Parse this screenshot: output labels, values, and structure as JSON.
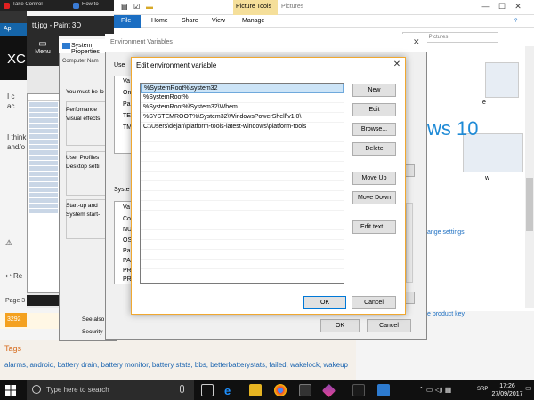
{
  "browser": {
    "tabs": [
      "Take Control",
      "How to"
    ],
    "blue_strip_text": "Ap",
    "dark_panel_text": "XC",
    "body_snippets": [
      "I c",
      "ac",
      "I think",
      "and/o"
    ],
    "button_re": "Re",
    "page_label": "Page 3",
    "number_badge": "3292",
    "tags_title": "Tags",
    "tags_list": "alarms, android, battery drain, battery monitor, battery stats, bbs, betterbatterystats, failed, wakelock, wakeup"
  },
  "paint": {
    "title": "tt.jpg - Paint 3D",
    "menu_label": "Menu"
  },
  "explorer": {
    "picture_tools": "Picture Tools",
    "pictures_title": "Pictures",
    "ribbon_tabs": [
      "File",
      "Home",
      "Share",
      "View",
      "Manage"
    ],
    "search_placeholder": "Search Pictures",
    "win10_text": "ws 10",
    "change_settings": "ange settings",
    "product_key": "e product key",
    "thumb_e": "e",
    "thumb_w": "w"
  },
  "system_properties": {
    "title": "System Properties",
    "tab_text": "Computer Nam",
    "lines": [
      "You must be lo",
      "Perfomance",
      "Visual effects",
      "User Profiles",
      "Desktop setti",
      "Start-up and",
      "System start-",
      "See also",
      "Security"
    ]
  },
  "env_vars": {
    "title": "Environment Variables",
    "user_label": "Use",
    "user_cols": [
      "Va",
      "On",
      "Pa",
      "TE",
      "TM"
    ],
    "sys_label": "Syste",
    "sys_cols": [
      "Va",
      "Co",
      "NU",
      "OS",
      "Pa",
      "PA",
      "PR",
      "PR"
    ],
    "ok": "OK",
    "cancel": "Cancel"
  },
  "edit_dialog": {
    "title": "Edit environment variable",
    "entries": [
      "%SystemRoot%\\system32",
      "%SystemRoot%",
      "%SystemRoot%\\System32\\Wbem",
      "%SYSTEMROOT%\\System32\\WindowsPowerShell\\v1.0\\",
      "C:\\Users\\dejan\\platform-tools-latest-windows\\platform-tools"
    ],
    "buttons": {
      "new": "New",
      "edit": "Edit",
      "browse": "Browse...",
      "delete": "Delete",
      "move_up": "Move Up",
      "move_down": "Move Down",
      "edit_text": "Edit text..."
    },
    "ok": "OK",
    "cancel": "Cancel"
  },
  "taskbar": {
    "search_placeholder": "Type here to search",
    "language": "SRP",
    "time": "17:26",
    "date": "27/09/2017"
  },
  "colors": {
    "accent": "#0078d7",
    "selection": "#cce4f7",
    "badge": "#f4a11f",
    "tag_link": "#1a64b0"
  }
}
